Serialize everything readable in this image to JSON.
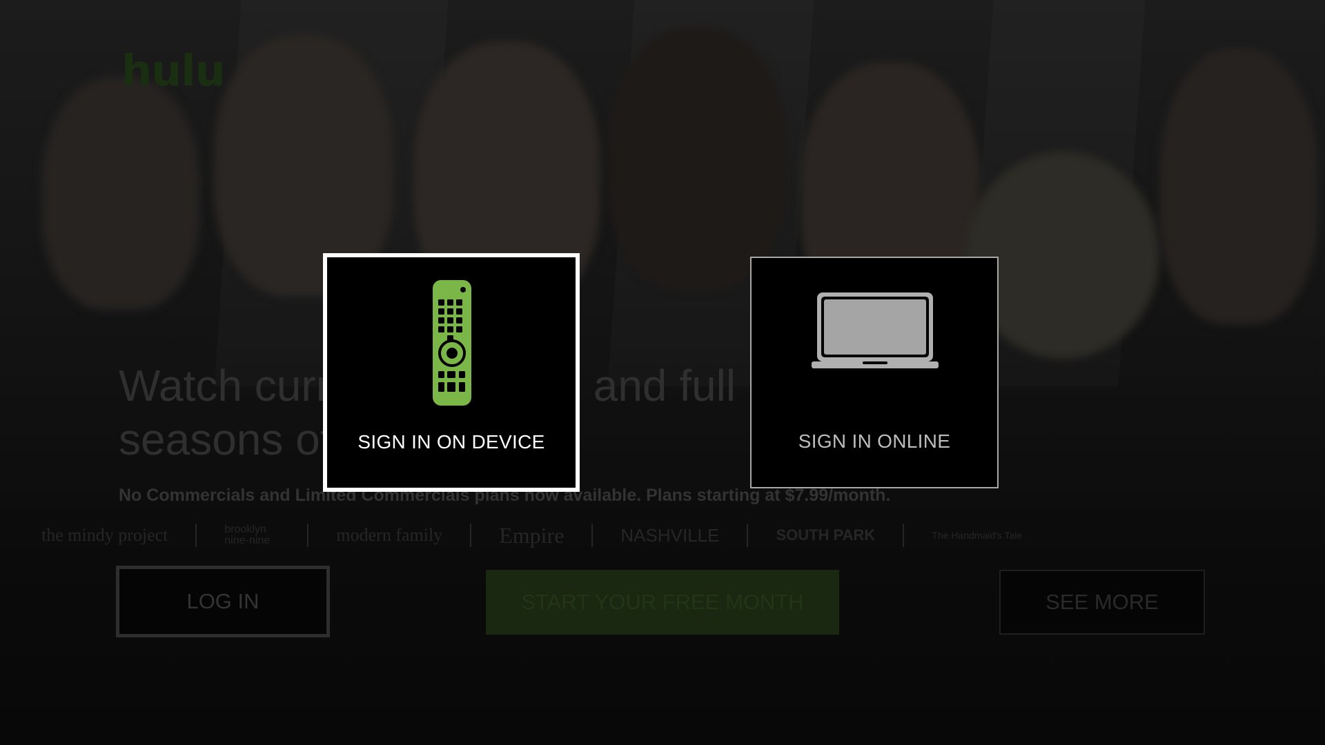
{
  "brand": {
    "logo_text": "hulu",
    "accent": "#7ab648"
  },
  "hero": {
    "headline": "Watch current episodes and full seasons of hit shows.",
    "subline": "No Commercials and Limited Commercials plans now available. Plans starting at $7.99/month.",
    "featured_shows": [
      "the mindy project",
      "brooklyn nine-nine",
      "modern family",
      "Empire",
      "NASHVILLE",
      "SOUTH PARK",
      "The Handmaid's Tale"
    ]
  },
  "actions": {
    "login_label": "LOG IN",
    "free_trial_label": "START YOUR FREE MONTH",
    "see_more_label": "SEE MORE"
  },
  "sign_in_options": {
    "device": {
      "label": "SIGN IN ON DEVICE",
      "icon": "remote-control-icon",
      "selected": true
    },
    "online": {
      "label": "SIGN IN ONLINE",
      "icon": "laptop-icon",
      "selected": false
    }
  },
  "colors": {
    "remote_green": "#7ab648",
    "laptop_gray": "#a9a9a9",
    "focus_border": "#ffffff"
  }
}
